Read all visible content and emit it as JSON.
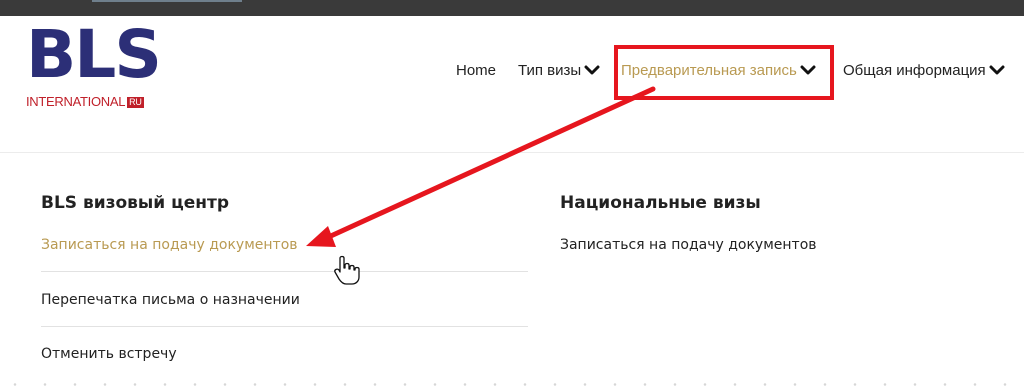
{
  "logo": {
    "main": "BLS",
    "sub": "INTERNATIONAL",
    "badge": "RU"
  },
  "nav": {
    "home": "Home",
    "visa_type": "Тип визы",
    "appointment": "Предварительная запись",
    "general_info": "Общая информация"
  },
  "menu": {
    "left": {
      "title": "BLS визовый центр",
      "items": [
        {
          "label": "Записаться на подачу документов"
        },
        {
          "label": "Перепечатка письма о назначении"
        },
        {
          "label": "Отменить встречу"
        }
      ]
    },
    "right": {
      "title": "Национальные визы",
      "items": [
        {
          "label": "Записаться на подачу документов"
        }
      ]
    }
  },
  "colors": {
    "brand_blue": "#2c2f77",
    "brand_red": "#c0202a",
    "gold_active": "#b99a52",
    "annotation_red": "#e6161e"
  },
  "icons": [
    "chevron-down-icon",
    "hand-pointer-cursor-icon",
    "annotation-arrow"
  ]
}
